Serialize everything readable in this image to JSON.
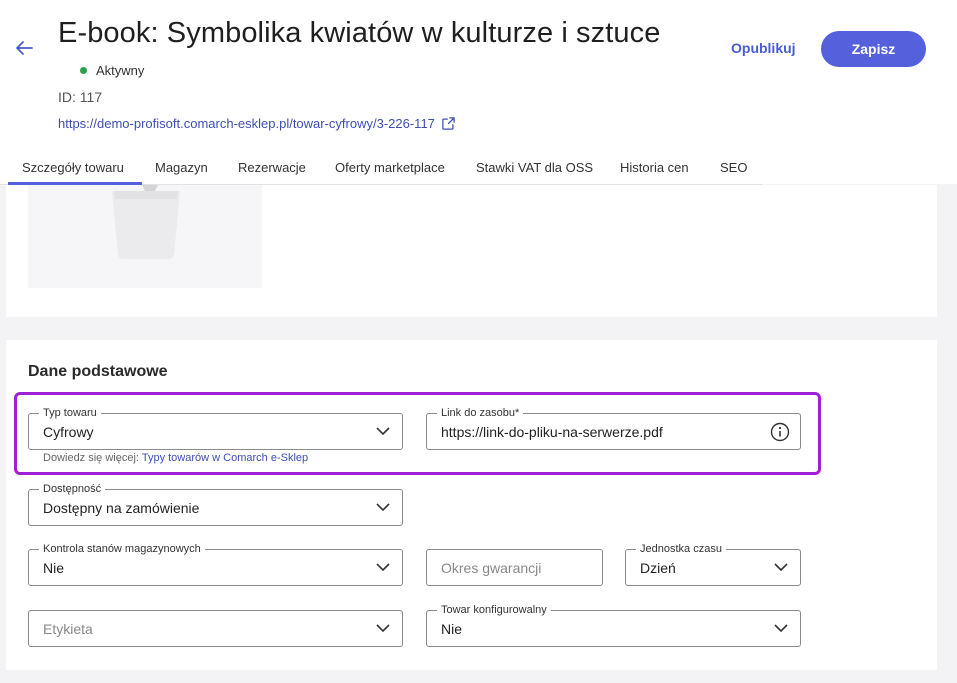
{
  "header": {
    "title": "E-book: Symbolika kwiatów w kulturze i sztuce",
    "status": "Aktywny",
    "id_label": "ID: 117",
    "url": "https://demo-profisoft.comarch-esklep.pl/towar-cyfrowy/3-226-117",
    "publish_label": "Opublikuj",
    "save_label": "Zapisz"
  },
  "tabs": [
    {
      "label": "Szczegóły towaru",
      "active": true
    },
    {
      "label": "Magazyn"
    },
    {
      "label": "Rezerwacje"
    },
    {
      "label": "Oferty marketplace"
    },
    {
      "label": "Stawki VAT dla OSS"
    },
    {
      "label": "Historia cen"
    },
    {
      "label": "SEO"
    }
  ],
  "section": {
    "title": "Dane podstawowe"
  },
  "fields": {
    "typ_towaru": {
      "label": "Typ towaru",
      "value": "Cyfrowy"
    },
    "helper_prefix": "Dowiedz się więcej: ",
    "helper_link": "Typy towarów w Comarch e-Sklep",
    "link_zasobu": {
      "label": "Link do zasobu*",
      "value": "https://link-do-pliku-na-serwerze.pdf"
    },
    "dostepnosc": {
      "label": "Dostępność",
      "value": "Dostępny na zamówienie"
    },
    "kontrola": {
      "label": "Kontrola stanów magazynowych",
      "value": "Nie"
    },
    "okres_gwarancji": {
      "placeholder": "Okres gwarancji"
    },
    "jednostka_czasu": {
      "label": "Jednostka czasu",
      "value": "Dzień"
    },
    "etykieta": {
      "placeholder": "Etykieta"
    },
    "towar_konfigurowalny": {
      "label": "Towar konfigurowalny",
      "value": "Nie"
    }
  },
  "colors": {
    "accent": "#5460dc",
    "highlight": "#a020d6",
    "status_active": "#2e9e48",
    "link": "#3d4fb5"
  },
  "icons": [
    "arrow-left-icon",
    "external-link-icon",
    "chevron-down-icon",
    "info-icon"
  ]
}
